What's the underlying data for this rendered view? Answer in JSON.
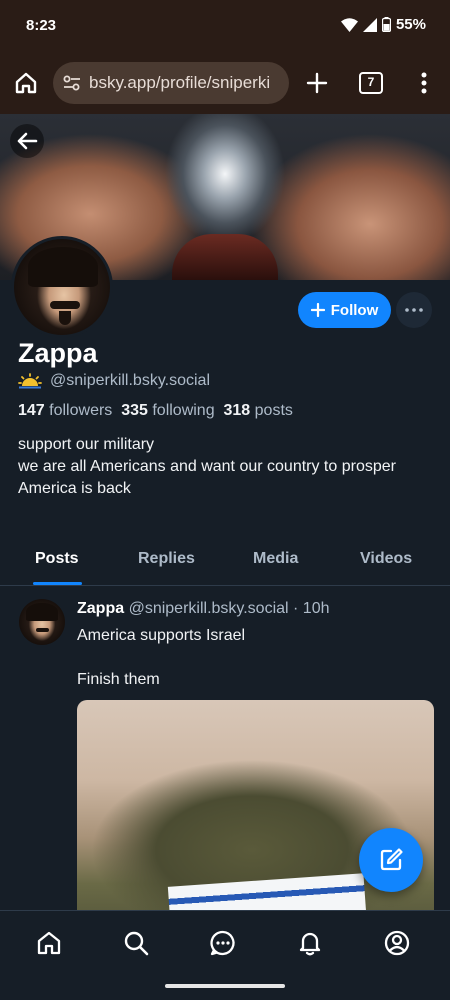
{
  "status_bar": {
    "time": "8:23",
    "battery": "55%"
  },
  "browser": {
    "url": "bsky.app/profile/sniperki",
    "tab_count": "7"
  },
  "profile": {
    "display_name": "Zappa",
    "handle": "@sniperkill.bsky.social",
    "followers_count": "147",
    "followers_label": "followers",
    "following_count": "335",
    "following_label": "following",
    "posts_count": "318",
    "posts_label": "posts",
    "bio": [
      "support our military",
      "we are all Americans and want our country to prosper",
      "America is back"
    ],
    "follow_label": "Follow"
  },
  "tabs": [
    "Posts",
    "Replies",
    "Media",
    "Videos"
  ],
  "active_tab": "Posts",
  "post": {
    "author": "Zappa",
    "meta": "@sniperkill.bsky.social · 10h",
    "lines": [
      "America supports Israel",
      "Finish them"
    ]
  },
  "bottom_nav": [
    "home-icon",
    "search-icon",
    "chat-icon",
    "notifications-icon",
    "profile-icon"
  ],
  "colors": {
    "accent": "#1185fe",
    "background": "#161e27",
    "browser_chrome": "#2a1c16"
  }
}
